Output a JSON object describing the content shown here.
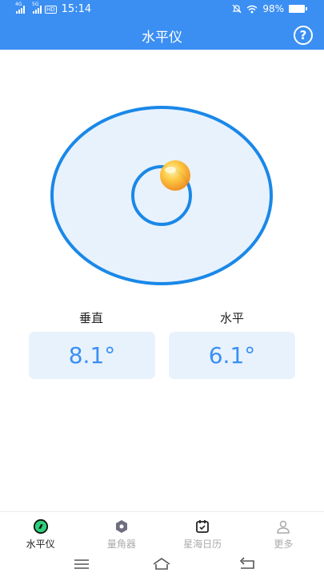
{
  "status_bar": {
    "network_left": "4G",
    "network_right": "5G",
    "hd": "HD",
    "time": "15:14",
    "battery": "98%"
  },
  "header": {
    "title": "水平仪",
    "help_icon": "?"
  },
  "level": {
    "bubble_color": "#f5a623",
    "ring_color": "#1a88e8",
    "fill_color": "#e8f2fd"
  },
  "readings": {
    "vertical": {
      "label": "垂直",
      "value": "8.1°"
    },
    "horizontal": {
      "label": "水平",
      "value": "6.1°"
    }
  },
  "tabs": [
    {
      "label": "水平仪",
      "icon": "level-icon",
      "active": true
    },
    {
      "label": "量角器",
      "icon": "protractor-icon",
      "active": false
    },
    {
      "label": "星海日历",
      "icon": "calendar-icon",
      "active": false
    },
    {
      "label": "更多",
      "icon": "user-icon",
      "active": false
    }
  ],
  "colors": {
    "primary": "#3b8ff3",
    "value_bg": "#e8f2fd"
  }
}
